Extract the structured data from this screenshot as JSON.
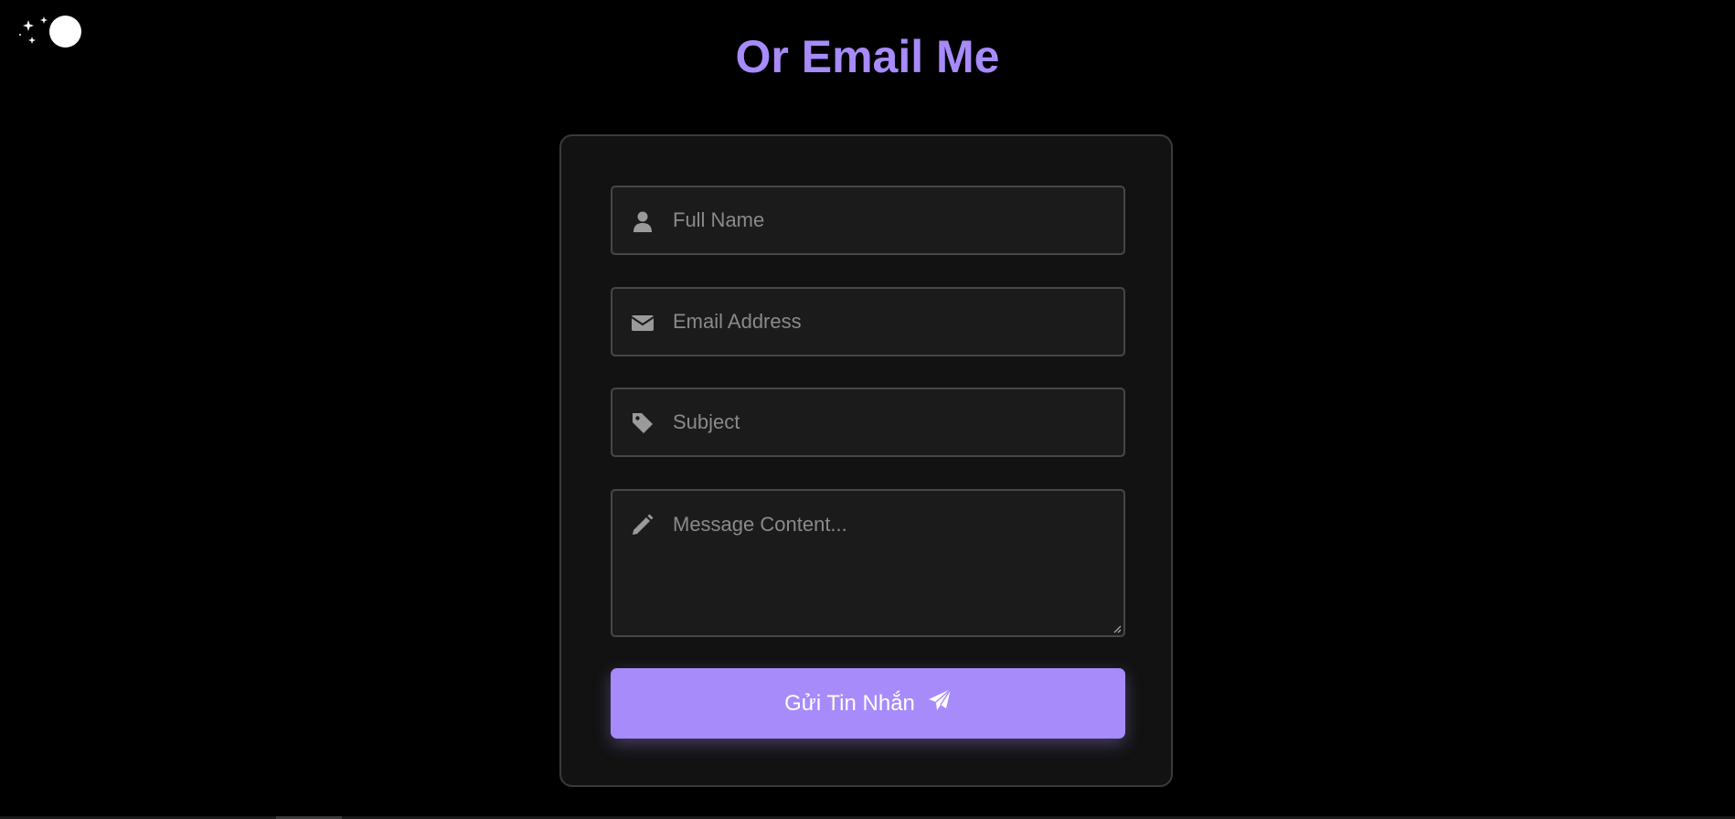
{
  "page": {
    "title": "Or Email Me",
    "accent_color": "#a78bfa",
    "background_color": "#000000"
  },
  "theme_toggle": {
    "icon": "moon-stars-icon"
  },
  "form": {
    "full_name": {
      "placeholder": "Full Name",
      "value": "",
      "icon": "user-icon"
    },
    "email": {
      "placeholder": "Email Address",
      "value": "",
      "icon": "envelope-icon"
    },
    "subject": {
      "placeholder": "Subject",
      "value": "",
      "icon": "tag-icon"
    },
    "message": {
      "placeholder": "Message Content...",
      "value": "",
      "icon": "pencil-icon"
    },
    "submit": {
      "label": "Gửi Tin Nhắn",
      "icon": "paper-plane-icon"
    }
  }
}
